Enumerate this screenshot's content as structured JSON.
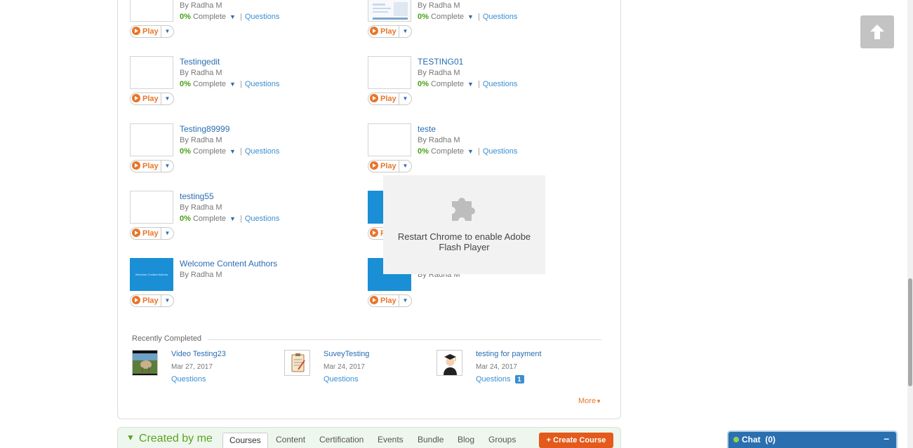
{
  "courses": [
    {
      "title": "",
      "author": "By Radha M",
      "progress": "0%",
      "status": "Complete",
      "questions": "Questions",
      "play": "Play",
      "thumb": "blank"
    },
    {
      "title": "",
      "author": "By Radha M",
      "progress": "0%",
      "status": "Complete",
      "questions": "Questions",
      "play": "Play",
      "thumb": "screenshot"
    },
    {
      "title": "Testingedit",
      "author": "By Radha M",
      "progress": "0%",
      "status": "Complete",
      "questions": "Questions",
      "play": "Play",
      "thumb": "blank"
    },
    {
      "title": "TESTING01",
      "author": "By Radha M",
      "progress": "0%",
      "status": "Complete",
      "questions": "Questions",
      "play": "Play",
      "thumb": "blank"
    },
    {
      "title": "Testing89999",
      "author": "By Radha M",
      "progress": "0%",
      "status": "Complete",
      "questions": "Questions",
      "play": "Play",
      "thumb": "blank"
    },
    {
      "title": "teste",
      "author": "By Radha M",
      "progress": "0%",
      "status": "Complete",
      "questions": "Questions",
      "play": "Play",
      "thumb": "blank"
    },
    {
      "title": "testing55",
      "author": "By Radha M",
      "progress": "0%",
      "status": "Complete",
      "questions": "Questions",
      "play": "Play",
      "thumb": "blank"
    },
    {
      "title": "",
      "author": "",
      "progress": "",
      "status": "",
      "questions": "",
      "play": "P",
      "thumb": "blue"
    },
    {
      "title": "Welcome Content Authors",
      "author": "By Radha M",
      "progress": "",
      "status": "",
      "questions": "",
      "play": "Play",
      "thumb": "blue",
      "thumb_text": "Welcome Content Authors"
    },
    {
      "title": "",
      "author": "By Radha M",
      "progress": "",
      "status": "",
      "questions": "",
      "play": "Play",
      "thumb": "blue"
    }
  ],
  "flash_notice": {
    "message": "Restart Chrome to enable Adobe Flash Player",
    "icon": "puzzle-icon"
  },
  "recently_completed": {
    "title": "Recently Completed",
    "items": [
      {
        "name": "Video Testing23",
        "date": "Mar 27, 2017",
        "questions": "Questions",
        "badge": "",
        "thumb": "video"
      },
      {
        "name": "SuveyTesting",
        "date": "Mar 24, 2017",
        "questions": "Questions",
        "badge": "",
        "thumb": "survey"
      },
      {
        "name": "testing for payment",
        "date": "Mar 24, 2017",
        "questions": "Questions",
        "badge": "1",
        "thumb": "graduate"
      }
    ],
    "more": "More"
  },
  "created_by_me": {
    "title": "Created by me",
    "tabs": [
      "Courses",
      "Content",
      "Certification",
      "Events",
      "Bundle",
      "Blog",
      "Groups"
    ],
    "active_tab": "Courses",
    "create_button": "+ Create Course"
  },
  "chat": {
    "label": "Chat",
    "count": "(0)",
    "minimize": "–"
  },
  "scroll_top": {
    "icon": "arrow-up-icon"
  },
  "colors": {
    "accent_orange": "#e8762b",
    "link_blue": "#2a6db2",
    "progress_green": "#43a313",
    "chat_blue": "#2a6fb0",
    "create_button": "#e35a1c"
  }
}
